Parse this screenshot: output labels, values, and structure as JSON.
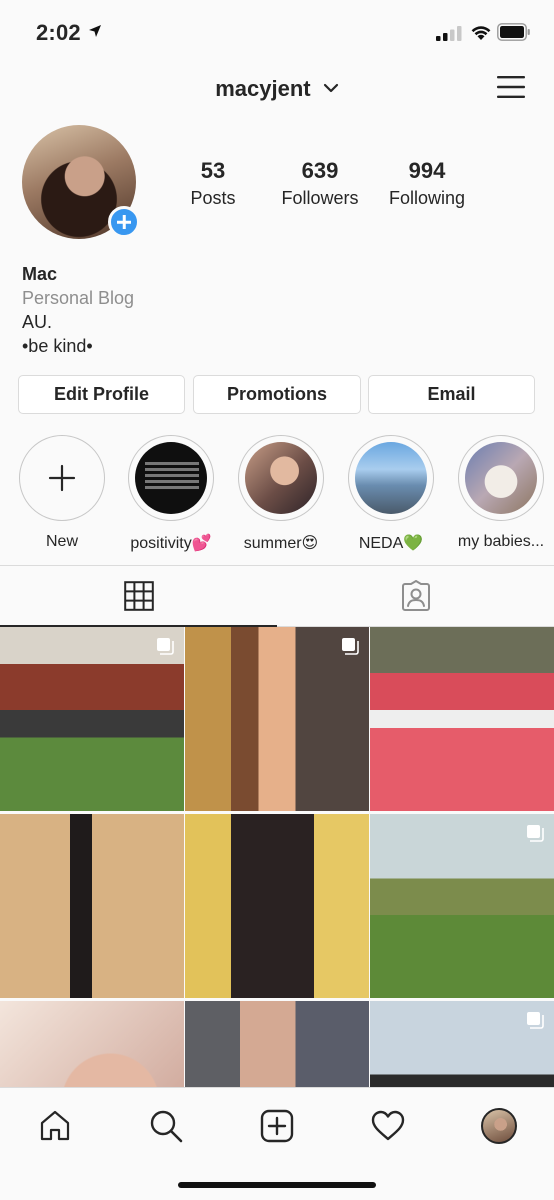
{
  "status_bar": {
    "time": "2:02"
  },
  "header": {
    "username": "macyjent"
  },
  "profile": {
    "stats": [
      {
        "value": "53",
        "label": "Posts"
      },
      {
        "value": "639",
        "label": "Followers"
      },
      {
        "value": "994",
        "label": "Following"
      }
    ],
    "name": "Mac",
    "category": "Personal Blog",
    "bio_lines": [
      "AU.",
      "•be kind•"
    ]
  },
  "buttons": {
    "edit_profile": "Edit Profile",
    "promotions": "Promotions",
    "email": "Email"
  },
  "highlights": [
    {
      "label": "New"
    },
    {
      "label": "positivity💕"
    },
    {
      "label": "summer😍"
    },
    {
      "label": "NEDA💚"
    },
    {
      "label": "my babies..."
    }
  ],
  "tabs": {
    "active": "grid",
    "icons": [
      "grid-icon",
      "tagged-icon"
    ]
  },
  "posts": [
    {
      "multiple": true
    },
    {
      "multiple": true
    },
    {
      "multiple": false
    },
    {
      "multiple": false
    },
    {
      "multiple": false
    },
    {
      "multiple": true
    },
    {
      "multiple": false
    },
    {
      "multiple": false
    },
    {
      "multiple": true
    }
  ],
  "nav": {
    "icons": [
      "home-icon",
      "search-icon",
      "add-post-icon",
      "heart-icon",
      "profile-avatar"
    ]
  },
  "colors": {
    "accent": "#3897f0",
    "text": "#262626",
    "muted": "#8e8e8e",
    "border": "#dbdbdb",
    "background": "#fafafa"
  }
}
